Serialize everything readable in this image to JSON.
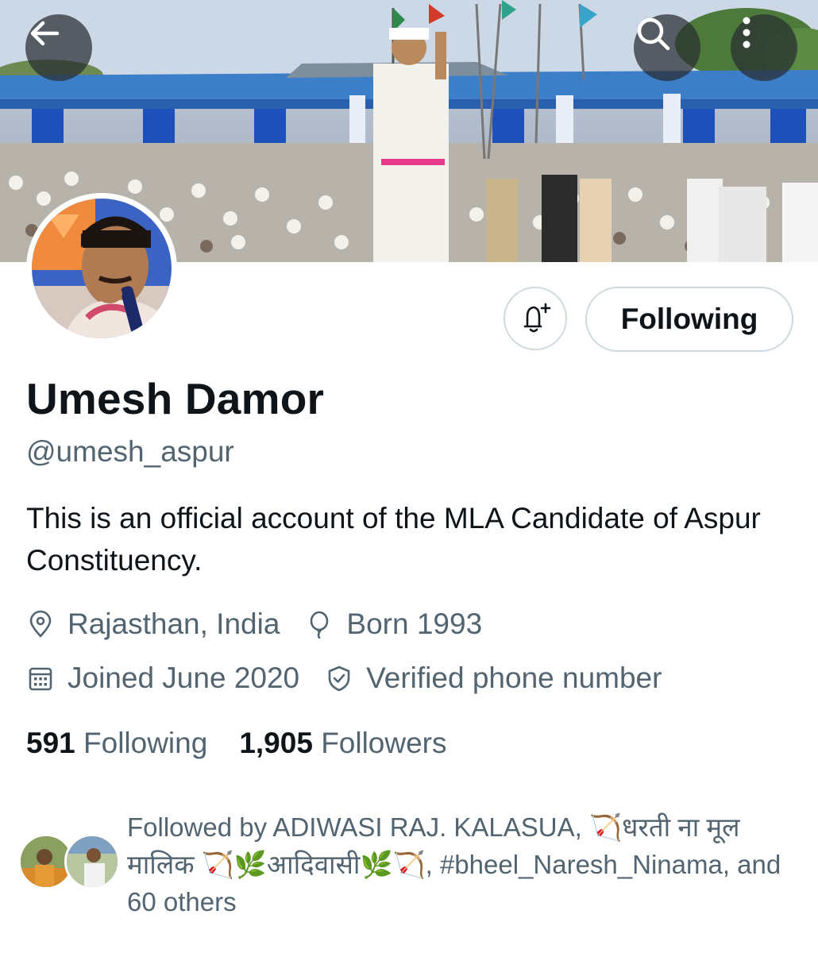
{
  "header": {
    "back_icon": "arrow-left-icon",
    "search_icon": "search-icon",
    "more_icon": "more-vertical-icon"
  },
  "profile": {
    "name": "Umesh Damor",
    "handle": "@umesh_aspur",
    "bio": "This is an official account of the MLA Candidate of Aspur Constituency.",
    "location": "Rajasthan, India",
    "born": "Born 1993",
    "joined": "Joined June 2020",
    "verified_phone": "Verified phone number"
  },
  "actions": {
    "notify_icon": "bell-plus-icon",
    "follow_label": "Following"
  },
  "stats": {
    "following_count": "591",
    "following_label": "Following",
    "followers_count": "1,905",
    "followers_label": "Followers"
  },
  "followed_by": {
    "text": "Followed by ADIWASI RAJ. KALASUA, 🏹धरती ना मूल मालिक 🏹🌿आदिवासी🌿🏹, #bheel_Naresh_Ninama, and 60 others"
  },
  "colors": {
    "primary_text": "#0f1419",
    "secondary_text": "#536471",
    "border": "#cfd9de"
  }
}
